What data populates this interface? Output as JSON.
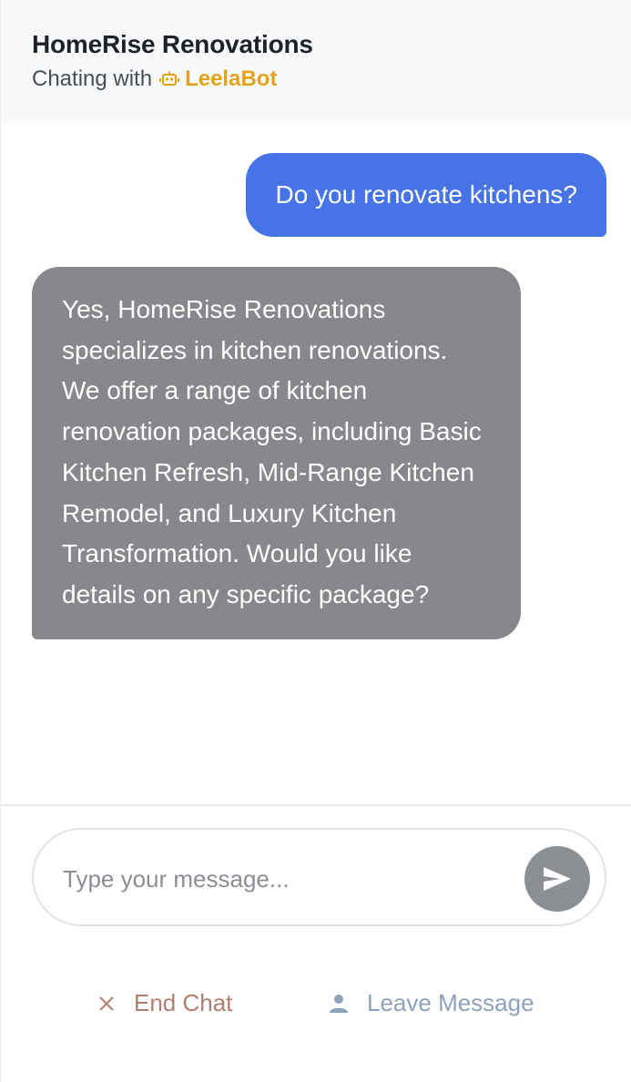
{
  "header": {
    "title": "HomeRise Renovations",
    "subtitle_prefix": "Chating with",
    "bot_icon": "robot-icon",
    "bot_name": "LeelaBot"
  },
  "messages": [
    {
      "sender": "user",
      "text": "Do you renovate kitchens?"
    },
    {
      "sender": "bot",
      "text": "Yes, HomeRise Renovations specializes in kitchen renovations. We offer a range of kitchen renovation packages, including Basic Kitchen Refresh, Mid-Range Kitchen Remodel, and Luxury Kitchen Transformation. Would you like details on any specific package?"
    }
  ],
  "composer": {
    "placeholder": "Type your message...",
    "value": "",
    "send_icon": "send-icon"
  },
  "actions": {
    "end_chat_label": "End Chat",
    "end_chat_icon": "close-icon",
    "leave_message_label": "Leave Message",
    "leave_message_icon": "person-icon"
  },
  "colors": {
    "user_bubble": "#4673e6",
    "bot_bubble": "#87888c",
    "bot_name": "#e3a21a",
    "end_chat": "#b07f72",
    "leave_message": "#8ea1bb",
    "send_button": "#8c9094"
  }
}
